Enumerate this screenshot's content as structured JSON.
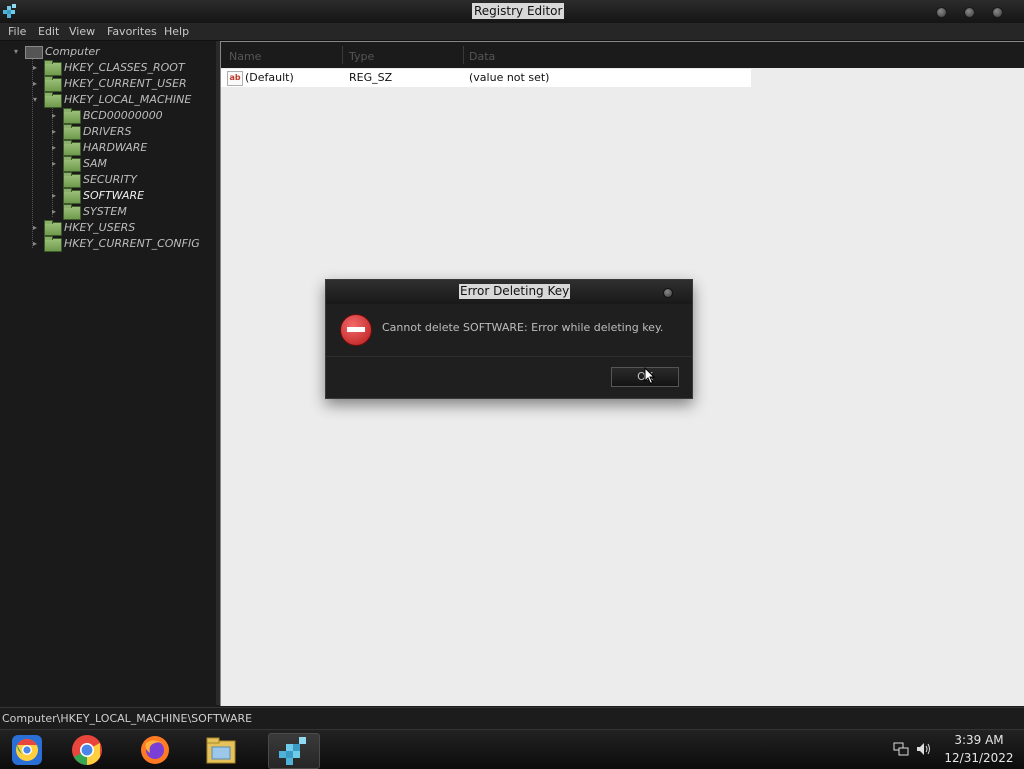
{
  "window": {
    "title": "Registry Editor"
  },
  "menu": [
    "File",
    "Edit",
    "View",
    "Favorites",
    "Help"
  ],
  "tree": {
    "root": "Computer",
    "items": [
      {
        "label": "HKEY_CLASSES_ROOT",
        "level": 1,
        "expanded": false,
        "selected": false
      },
      {
        "label": "HKEY_CURRENT_USER",
        "level": 1,
        "expanded": false,
        "selected": false
      },
      {
        "label": "HKEY_LOCAL_MACHINE",
        "level": 1,
        "expanded": true,
        "selected": false
      },
      {
        "label": "BCD00000000",
        "level": 2,
        "expanded": false,
        "selected": false
      },
      {
        "label": "DRIVERS",
        "level": 2,
        "expanded": false,
        "selected": false
      },
      {
        "label": "HARDWARE",
        "level": 2,
        "expanded": false,
        "selected": false
      },
      {
        "label": "SAM",
        "level": 2,
        "expanded": false,
        "selected": false
      },
      {
        "label": "SECURITY",
        "level": 2,
        "expanded": false,
        "selected": false
      },
      {
        "label": "SOFTWARE",
        "level": 2,
        "expanded": false,
        "selected": true
      },
      {
        "label": "SYSTEM",
        "level": 2,
        "expanded": false,
        "selected": false
      },
      {
        "label": "HKEY_USERS",
        "level": 1,
        "expanded": false,
        "selected": false
      },
      {
        "label": "HKEY_CURRENT_CONFIG",
        "level": 1,
        "expanded": false,
        "selected": false
      }
    ]
  },
  "list": {
    "columns": [
      "Name",
      "Type",
      "Data"
    ],
    "rows": [
      {
        "icon": "string-value-icon",
        "name": "(Default)",
        "type": "REG_SZ",
        "data": "(value not set)"
      }
    ]
  },
  "status": {
    "path": "Computer\\HKEY_LOCAL_MACHINE\\SOFTWARE"
  },
  "dialog": {
    "title": "Error Deleting Key",
    "icon": "error-icon",
    "message": "Cannot delete SOFTWARE:  Error while deleting key.",
    "ok_label": "OK"
  },
  "taskbar": {
    "apps": [
      "chromium-icon",
      "chrome-icon",
      "firefox-icon",
      "file-manager-icon",
      "registry-editor-icon"
    ],
    "time": "3:39 AM",
    "date": "12/31/2022"
  },
  "colors": {
    "accent_folder": "#8ab06a",
    "error": "#d32f2f",
    "list_bg": "#ececec"
  }
}
